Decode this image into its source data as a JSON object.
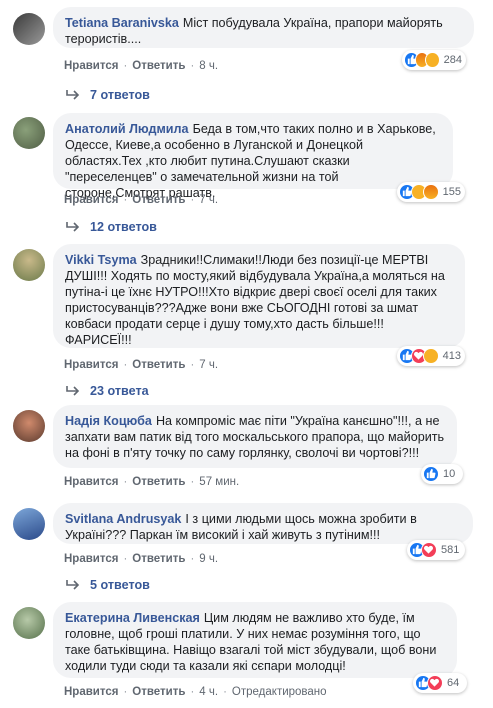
{
  "comments": [
    {
      "author": "Tetiana Baranivska",
      "text": "Міст побудувала Україна, прапори майорять терористів....",
      "reactions": [
        "like",
        "angry",
        "sad"
      ],
      "reaction_count": "284",
      "like_label": "Нравится",
      "reply_label": "Ответить",
      "time": "8 ч.",
      "replies_label": "7 ответов"
    },
    {
      "author": "Анатолий Людмила",
      "text": "Беда в том,что таких полно и в Харькове, Одессе, Киеве,а особенно в Луганской и Донецкой областях.Тех ,кто любит путина.Слушают сказки \"переселенцев\" о замечательной жизни на той стороне.Смотрят рашатв.",
      "reactions": [
        "like",
        "sad",
        "angry"
      ],
      "reaction_count": "155",
      "like_label": "Нравится",
      "reply_label": "Ответить",
      "time": "7 ч.",
      "replies_label": "12 ответов"
    },
    {
      "author": "Vikki Tsyma",
      "text": "Зрадники!!Слимаки!!Люди без позиції-це МЕРТВІ ДУШІ!!! Ходять по мосту,який відбудувала Україна,а моляться на путіна-і це їхнє НУТРО!!!Хто відкриє двері своєї оселі для таких пристосуванців???Адже вони вже СЬОГОДНІ готові за шмат ковбаси продати серце і душу тому,хто дасть більше!!! ФАРИСЕЇ!!!",
      "reactions": [
        "like",
        "heart",
        "sad"
      ],
      "reaction_count": "413",
      "like_label": "Нравится",
      "reply_label": "Ответить",
      "time": "7 ч.",
      "replies_label": "23 ответа"
    },
    {
      "author": "Надія Коцюба",
      "text": "На компроміс має піти \"Україна канєшно\"!!!, а не запхати вам патик від того москальського прапора, що майорить на фоні в п'яту точку по саму горлянку, сволочі ви чортові?!!!",
      "reactions": [
        "like"
      ],
      "reaction_count": "10",
      "like_label": "Нравится",
      "reply_label": "Ответить",
      "time": "57 мин.",
      "replies_label": ""
    },
    {
      "author": "Svitlana Andrusyak",
      "text": "І з цими людьми щось можна зробити в Україні??? Паркан їм високий і хай живуть з путіним!!!",
      "reactions": [
        "like",
        "heart"
      ],
      "reaction_count": "581",
      "like_label": "Нравится",
      "reply_label": "Ответить",
      "time": "9 ч.",
      "replies_label": "5 ответов"
    },
    {
      "author": "Екатерина Ливенская",
      "text": "Цим людям не важливо хто буде, їм головне, щоб гроші платили. У них немає розуміння того, що таке батьківщина. Навіщо взагалі той міст збудували, щоб вони ходили туди сюди та казали які сєпари молодці!",
      "reactions": [
        "like",
        "heart"
      ],
      "reaction_count": "64",
      "like_label": "Нравится",
      "reply_label": "Ответить",
      "time": "4 ч.",
      "edited_label": "Отредактировано",
      "replies_label": ""
    }
  ],
  "colors": {
    "author": "#385898",
    "bubble": "#f2f3f5",
    "meta": "#606770",
    "like": "#1877f2",
    "heart": "#f33e58",
    "sad": "#f7b125"
  }
}
